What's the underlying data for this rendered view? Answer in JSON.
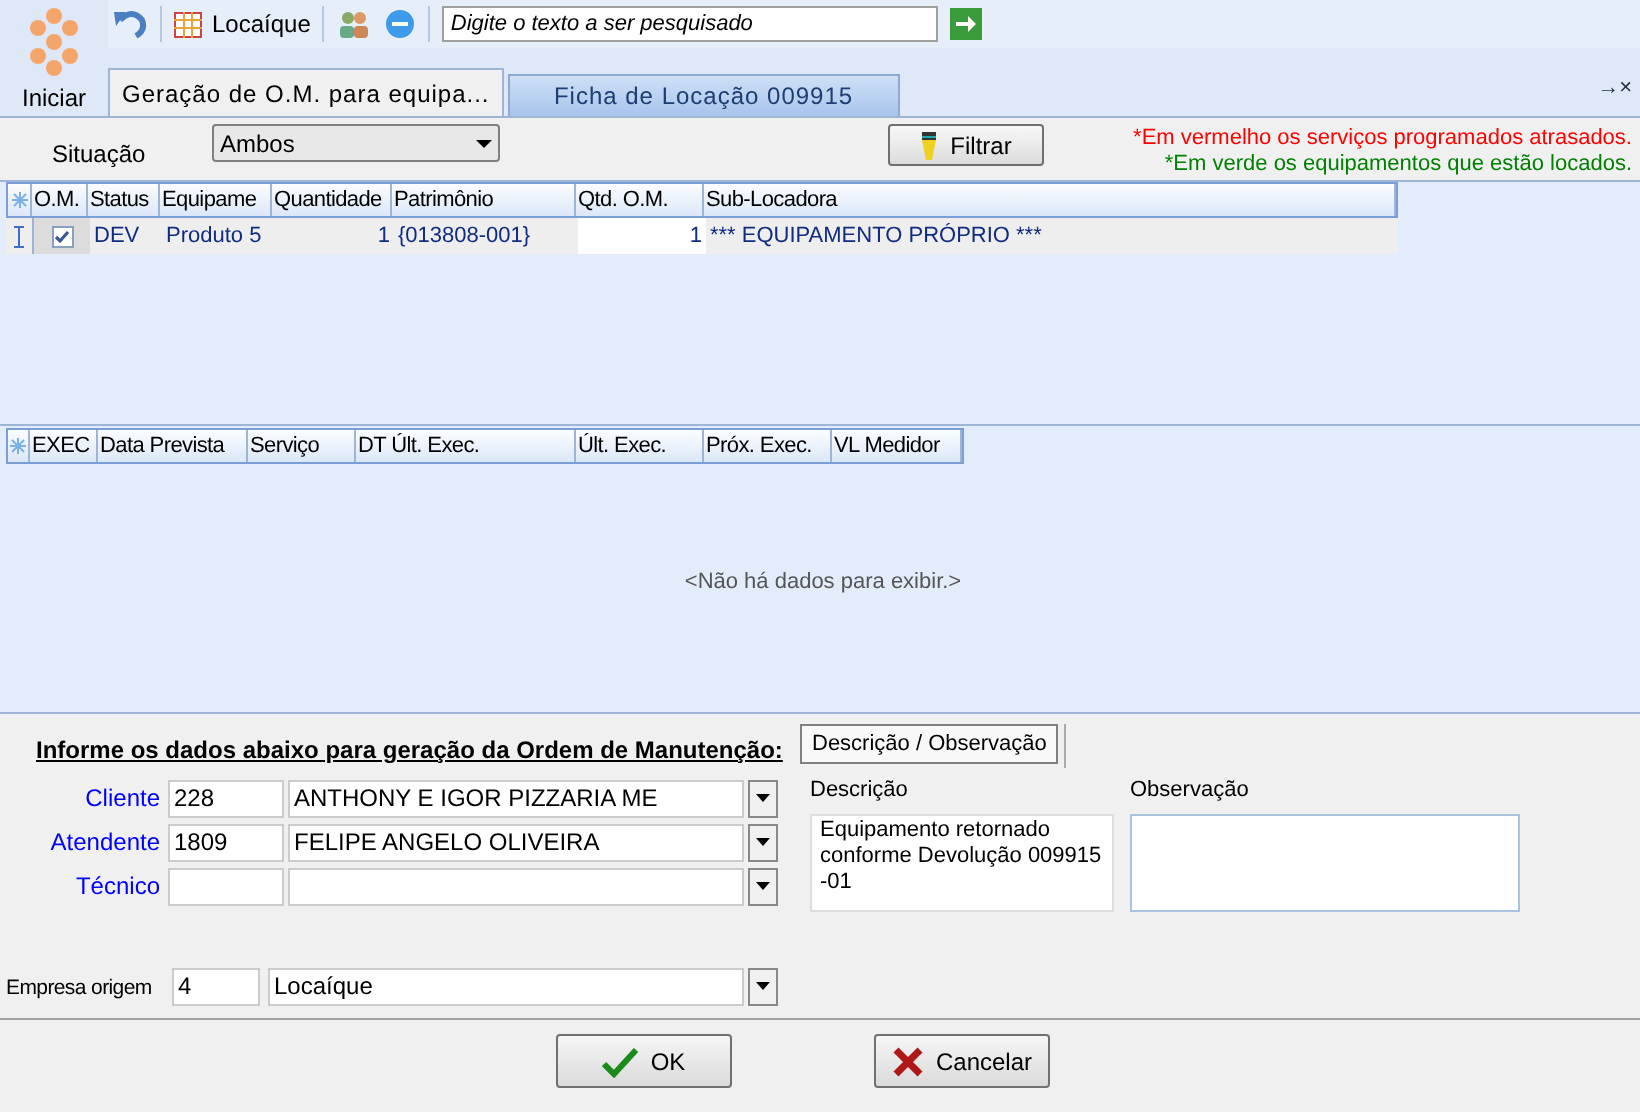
{
  "toolbar": {
    "start_label": "Iniciar",
    "company_button": "Locaíque",
    "search": {
      "placeholder": "Digite o texto a ser pesquisado"
    }
  },
  "tabs": [
    {
      "label": "Geração de O.M. para equipa...",
      "selected": true
    },
    {
      "label": "Ficha de Locação 009915",
      "selected": false
    }
  ],
  "tab_controls": "→×",
  "filter": {
    "label": "Situação",
    "value": "Ambos",
    "button": "Filtrar"
  },
  "legend": [
    {
      "text": "*Em vermelho os serviços programados atrasados.",
      "color": "#ff0000"
    },
    {
      "text": "*Em verde os equipamentos que estão locados.",
      "color": "#008000"
    }
  ],
  "equipment_table": {
    "columns": [
      "O.M.",
      "Status",
      "Equipame",
      "Quantidade",
      "Patrimônio",
      "Qtd. O.M.",
      "Sub-Locadora"
    ],
    "rows": [
      {
        "selected": true,
        "checked": true,
        "cells": [
          "",
          "DEV",
          "Produto 5",
          "1",
          "{013808-001}",
          "1",
          "*** EQUIPAMENTO PRÓPRIO ***"
        ]
      }
    ]
  },
  "services_table": {
    "columns": [
      "EXEC",
      "Data Prevista",
      "Serviço",
      "DT Últ. Exec.",
      "Últ. Exec.",
      "Próx. Exec.",
      "VL Medidor"
    ],
    "empty_message": "<Não há dados para exibir.>"
  },
  "form": {
    "title": "Informe os dados abaixo para geração da Ordem de Manutenção:",
    "fields": [
      {
        "label": "Cliente",
        "code": "228",
        "name": "ANTHONY E IGOR PIZZARIA ME"
      },
      {
        "label": "Atendente",
        "code": "1809",
        "name": "FELIPE ANGELO OLIVEIRA"
      },
      {
        "label": "Técnico"
      }
    ],
    "origin": {
      "label": "Empresa origem",
      "code": "4",
      "name": "Locaíque"
    }
  },
  "notes": {
    "tab": "Descrição / Observação",
    "description_label": "Descrição",
    "description": "Equipamento retornado conforme Devolução 009915 -01",
    "observation_label": "Observação"
  },
  "buttons": [
    {
      "kind": "ok",
      "label": "OK"
    },
    {
      "kind": "cancel",
      "label": "Cancelar"
    }
  ]
}
